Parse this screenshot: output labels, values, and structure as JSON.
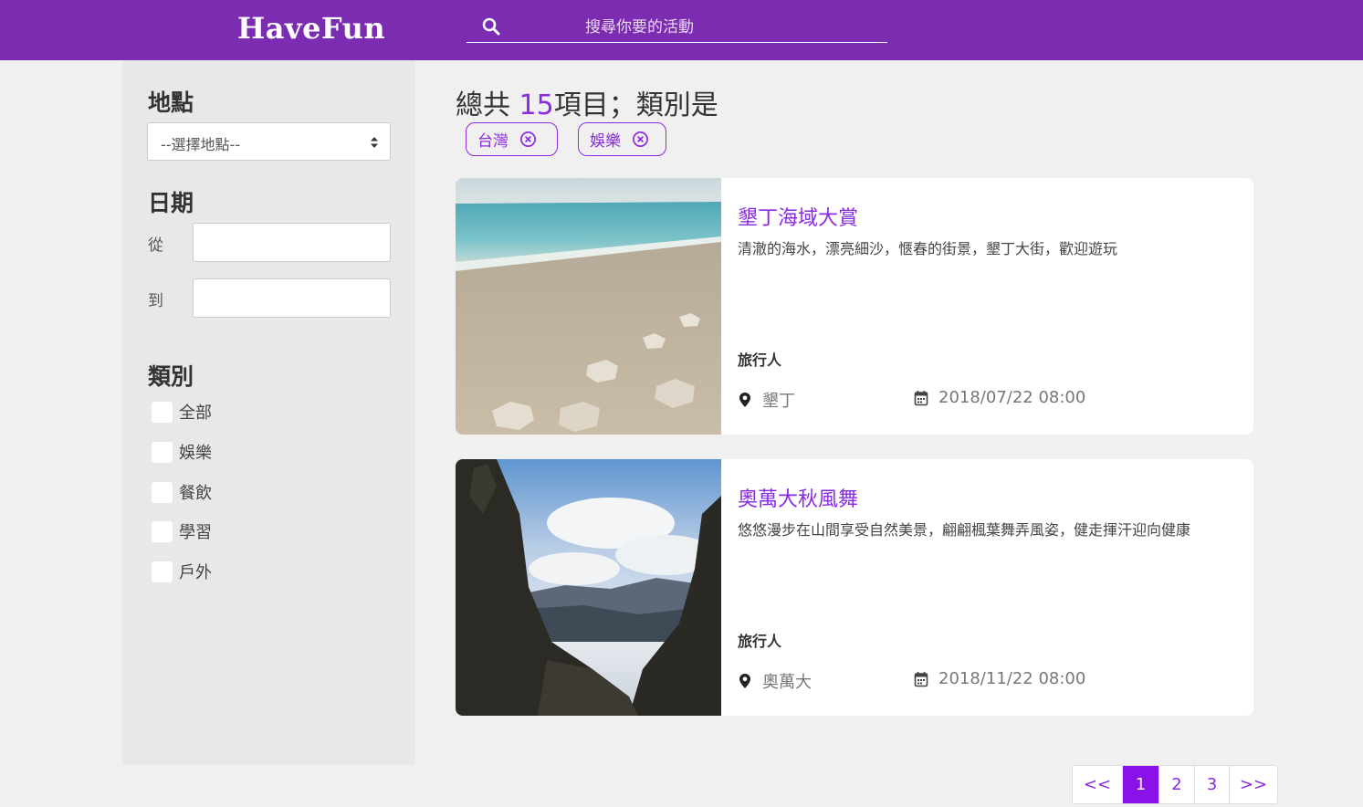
{
  "header": {
    "logo": "HaveFun",
    "search_placeholder": "搜尋你要的活動"
  },
  "sidebar": {
    "location": {
      "title": "地點",
      "select_value": "--選擇地點--"
    },
    "date": {
      "title": "日期",
      "from_label": "從",
      "to_label": "到"
    },
    "category": {
      "title": "類別",
      "items": [
        {
          "label": "全部",
          "checked": false
        },
        {
          "label": "娛樂",
          "checked": false
        },
        {
          "label": "餐飲",
          "checked": false
        },
        {
          "label": "學習",
          "checked": false
        },
        {
          "label": "戶外",
          "checked": false
        }
      ]
    }
  },
  "results": {
    "prefix": "總共 ",
    "count": "15",
    "suffix": "項目；類別是",
    "tags": [
      "台灣",
      "娛樂"
    ]
  },
  "events": [
    {
      "title": "墾丁海域大賞",
      "description": "清澈的海水，漂亮細沙，愜春的街景，墾丁大街，歡迎遊玩",
      "organizer": "旅行人",
      "location": "墾丁",
      "datetime": "2018/07/22 08:00"
    },
    {
      "title": "奧萬大秋風舞",
      "description": "悠悠漫步在山間享受自然美景，翩翩楓葉舞弄風姿，健走揮汗迎向健康",
      "organizer": "旅行人",
      "location": "奧萬大",
      "datetime": "2018/11/22 08:00"
    }
  ],
  "pagination": {
    "prev": "<<",
    "pages": [
      "1",
      "2",
      "3"
    ],
    "current": "1",
    "next": ">>"
  },
  "colors": {
    "header": "#7b2cb0",
    "accent": "#8a2be2",
    "active_page": "#8a12e8"
  }
}
